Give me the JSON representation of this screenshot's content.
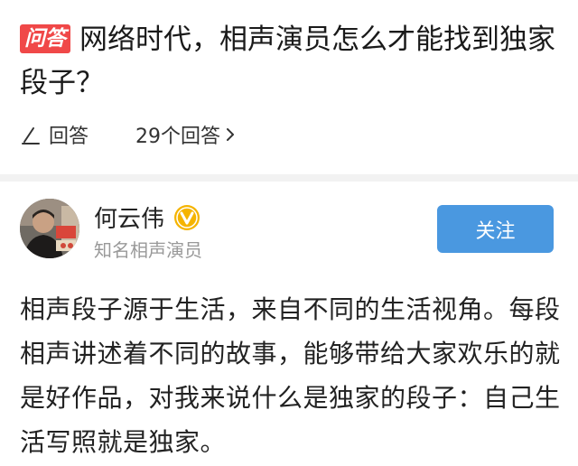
{
  "question": {
    "badge": "问答",
    "title": "网络时代，相声演员怎么才能找到独家段子？"
  },
  "answer_bar": {
    "answer_label": "回答",
    "count_label": "29个回答"
  },
  "author": {
    "name": "何云伟",
    "title": "知名相声演员",
    "follow_label": "关注",
    "avatar_icon": "avatar-photo",
    "verified_icon": "verified-v-icon"
  },
  "answer": {
    "text": "相声段子源于生活，来自不同的生活视角。每段相声讲述着不同的故事，能够带给大家欢乐的就是好作品，对我来说什么是独家的段子：自己生活写照就是独家。"
  },
  "colors": {
    "badge_bg": "#f04848",
    "follow_bg": "#4a98e0",
    "verified": "#f5b400"
  }
}
